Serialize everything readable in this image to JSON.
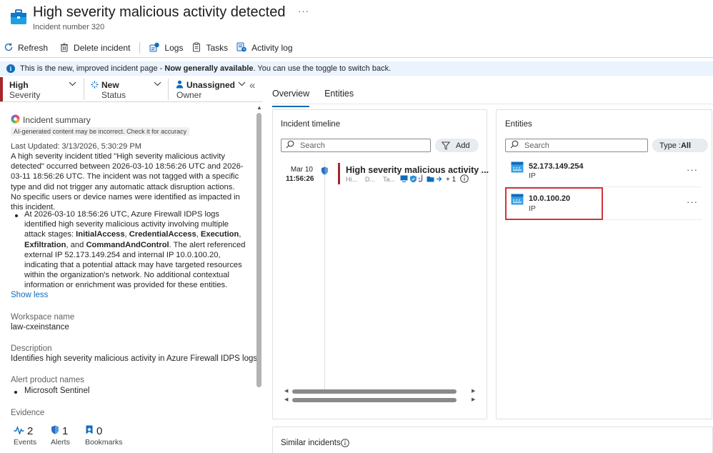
{
  "header": {
    "title": "High severity malicious activity detected",
    "subtitle": "Incident number 320",
    "more": "···"
  },
  "toolbar": {
    "refresh": "Refresh",
    "delete": "Delete incident",
    "logs": "Logs",
    "tasks": "Tasks",
    "activity_log": "Activity log"
  },
  "banner": {
    "info": "i",
    "text_before": "This is the new, improved incident page - ",
    "text_bold": "Now generally available",
    "text_after": ". You can use the toggle to switch back."
  },
  "status": {
    "severity_value": "High",
    "severity_label": "Severity",
    "status_value": "New",
    "status_label": "Status",
    "owner_value": "Unassigned",
    "owner_label": "Owner",
    "collapse": "«",
    "severity_color": "#a4262c"
  },
  "summary": {
    "heading": "Incident summary",
    "ai_badge": "AI-generated content may be incorrect. Check it for accuracy",
    "last_updated": "Last Updated: 3/13/2026, 5:30:29 PM",
    "paragraph": "A high severity incident titled \"High severity malicious activity detected\" occurred between 2026-03-10 18:56:26 UTC and 2026-03-11 18:56:26 UTC. The incident was not tagged with a specific type and did not trigger any automatic attack disruption actions. No specific users or device names were identified as impacted in this incident.",
    "bullet_a": "At 2026-03-10 18:56:26 UTC, Azure Firewall IDPS logs identified high severity malicious activity involving multiple attack stages: ",
    "stage1": "InitialAccess",
    "stage2": "CredentialAccess",
    "stage3": "Execution",
    "stage4": "Exfiltration",
    "stage5": "CommandAndControl",
    "sep1": ", ",
    "sep_and": ", and ",
    "bullet_b": ". The alert referenced external IP 52.173.149.254 and internal IP 10.0.100.20, indicating that a potential attack may have targeted resources within the organization's network. No additional contextual information or enrichment was provided for these entities.",
    "show_less": "Show less"
  },
  "details": {
    "workspace_label": "Workspace name",
    "workspace_value": "law-cxeinstance",
    "description_label": "Description",
    "description_value": "Identifies high severity malicious activity in Azure Firewall IDPS logs.",
    "alert_products_label": "Alert product names",
    "alert_products": [
      "Microsoft Sentinel"
    ],
    "evidence_label": "Evidence",
    "evidence": [
      {
        "count": "2",
        "label": "Events"
      },
      {
        "count": "1",
        "label": "Alerts"
      },
      {
        "count": "0",
        "label": "Bookmarks"
      }
    ]
  },
  "tabs": [
    {
      "label": "Overview",
      "active": true
    },
    {
      "label": "Entities",
      "active": false
    }
  ],
  "timeline": {
    "title": "Incident timeline",
    "search_placeholder": "Search",
    "add": "Add",
    "items": [
      {
        "date": "Mar 10",
        "time": "11:56:26",
        "title": "High severity malicious activity ...",
        "meta": [
          "Hi...",
          "D...",
          "Ta..."
        ],
        "extra": "+ 1",
        "more": "·"
      }
    ]
  },
  "entities": {
    "title": "Entities",
    "search_placeholder": "Search",
    "type_filter_label": "Type : ",
    "type_filter_value": "All",
    "items": [
      {
        "name": "52.173.149.254",
        "type": "IP",
        "more": "···"
      },
      {
        "name": "10.0.100.20",
        "type": "IP",
        "more": "···"
      }
    ]
  },
  "similar": {
    "title": "Similar incidents"
  },
  "colors": {
    "accent": "#0f6cbd",
    "severity_high": "#a4262c",
    "highlight_box": "#d13438"
  }
}
